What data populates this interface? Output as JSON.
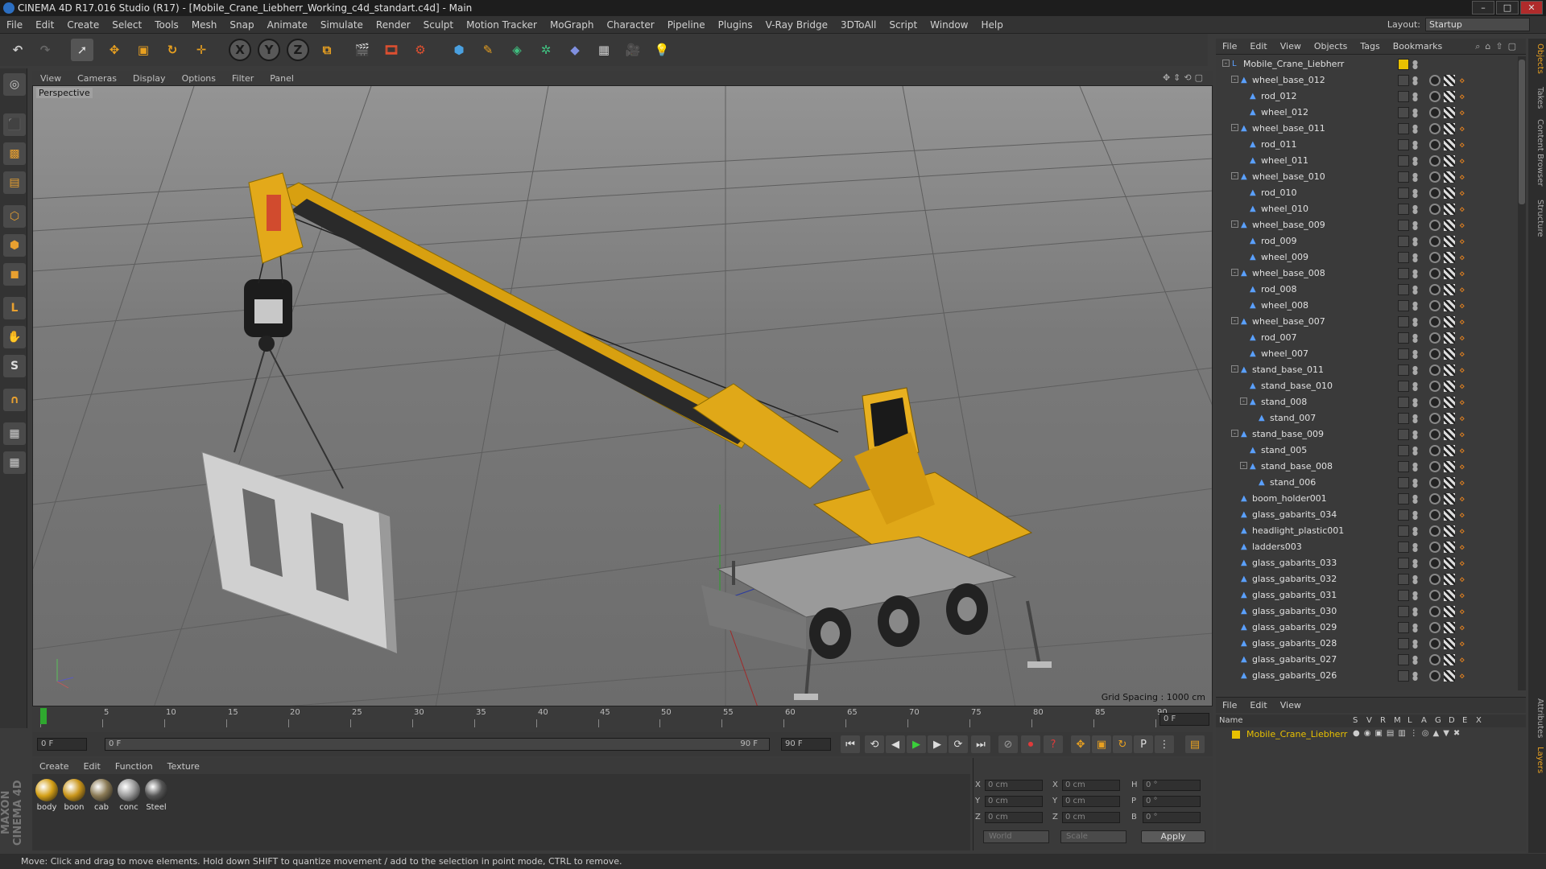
{
  "window": {
    "title": "CINEMA 4D R17.016 Studio (R17) - [Mobile_Crane_Liebherr_Working_c4d_standart.c4d] - Main"
  },
  "menubar": {
    "items": [
      "File",
      "Edit",
      "Create",
      "Select",
      "Tools",
      "Mesh",
      "Snap",
      "Animate",
      "Simulate",
      "Render",
      "Sculpt",
      "Motion Tracker",
      "MoGraph",
      "Character",
      "Pipeline",
      "Plugins",
      "V-Ray Bridge",
      "3DToAll",
      "Script",
      "Window",
      "Help"
    ],
    "layout_label": "Layout:",
    "layout_value": "Startup"
  },
  "toolbar": {
    "axis_x": "X",
    "axis_y": "Y",
    "axis_z": "Z"
  },
  "viewport": {
    "menu": [
      "View",
      "Cameras",
      "Display",
      "Options",
      "Filter",
      "Panel"
    ],
    "label": "Perspective",
    "grid_spacing": "Grid Spacing : 1000 cm"
  },
  "timeline": {
    "ticks": [
      "0",
      "5",
      "10",
      "15",
      "20",
      "25",
      "30",
      "35",
      "40",
      "45",
      "50",
      "55",
      "60",
      "65",
      "70",
      "75",
      "80",
      "85",
      "90"
    ],
    "current_frame": "0 F",
    "start_field": "0 F",
    "slider_left": "0 F",
    "slider_right": "90 F",
    "end_field": "90 F"
  },
  "materials": {
    "menu": [
      "Create",
      "Edit",
      "Function",
      "Texture"
    ],
    "items": [
      {
        "label": "body",
        "color": "#d4a017"
      },
      {
        "label": "boon",
        "color": "#c9951a"
      },
      {
        "label": "cab",
        "color": "#8a7a55"
      },
      {
        "label": "conc",
        "color": "#9a9a9a"
      },
      {
        "label": "Steel",
        "color": "#555555"
      }
    ]
  },
  "coords": {
    "x_label": "X",
    "y_label": "Y",
    "z_label": "Z",
    "x2_label": "X",
    "y2_label": "Y",
    "z2_label": "Z",
    "h_label": "H",
    "p_label": "P",
    "b_label": "B",
    "x_val": "0 cm",
    "y_val": "0 cm",
    "z_val": "0 cm",
    "x2_val": "0 cm",
    "y2_val": "0 cm",
    "z2_val": "0 cm",
    "h_val": "0 °",
    "p_val": "0 °",
    "b_val": "0 °",
    "world": "World",
    "scale": "Scale",
    "apply": "Apply"
  },
  "status": {
    "text": "Move: Click and drag to move elements. Hold down SHIFT to quantize movement / add to the selection in point mode, CTRL to remove."
  },
  "object_manager": {
    "menu": [
      "File",
      "Edit",
      "View",
      "Objects",
      "Tags",
      "Bookmarks"
    ],
    "objects": [
      {
        "name": "Mobile_Crane_Liebherr",
        "level": 0,
        "expand": "-"
      },
      {
        "name": "wheel_base_012",
        "level": 1,
        "expand": "-"
      },
      {
        "name": "rod_012",
        "level": 2,
        "expand": ""
      },
      {
        "name": "wheel_012",
        "level": 2,
        "expand": ""
      },
      {
        "name": "wheel_base_011",
        "level": 1,
        "expand": "-"
      },
      {
        "name": "rod_011",
        "level": 2,
        "expand": ""
      },
      {
        "name": "wheel_011",
        "level": 2,
        "expand": ""
      },
      {
        "name": "wheel_base_010",
        "level": 1,
        "expand": "-"
      },
      {
        "name": "rod_010",
        "level": 2,
        "expand": ""
      },
      {
        "name": "wheel_010",
        "level": 2,
        "expand": ""
      },
      {
        "name": "wheel_base_009",
        "level": 1,
        "expand": "-"
      },
      {
        "name": "rod_009",
        "level": 2,
        "expand": ""
      },
      {
        "name": "wheel_009",
        "level": 2,
        "expand": ""
      },
      {
        "name": "wheel_base_008",
        "level": 1,
        "expand": "-"
      },
      {
        "name": "rod_008",
        "level": 2,
        "expand": ""
      },
      {
        "name": "wheel_008",
        "level": 2,
        "expand": ""
      },
      {
        "name": "wheel_base_007",
        "level": 1,
        "expand": "-"
      },
      {
        "name": "rod_007",
        "level": 2,
        "expand": ""
      },
      {
        "name": "wheel_007",
        "level": 2,
        "expand": ""
      },
      {
        "name": "stand_base_011",
        "level": 1,
        "expand": "-"
      },
      {
        "name": "stand_base_010",
        "level": 2,
        "expand": ""
      },
      {
        "name": "stand_008",
        "level": 2,
        "expand": "-"
      },
      {
        "name": "stand_007",
        "level": 3,
        "expand": ""
      },
      {
        "name": "stand_base_009",
        "level": 1,
        "expand": "-"
      },
      {
        "name": "stand_005",
        "level": 2,
        "expand": ""
      },
      {
        "name": "stand_base_008",
        "level": 2,
        "expand": "-"
      },
      {
        "name": "stand_006",
        "level": 3,
        "expand": ""
      },
      {
        "name": "boom_holder001",
        "level": 1,
        "expand": ""
      },
      {
        "name": "glass_gabarits_034",
        "level": 1,
        "expand": ""
      },
      {
        "name": "headlight_plastic001",
        "level": 1,
        "expand": ""
      },
      {
        "name": "ladders003",
        "level": 1,
        "expand": ""
      },
      {
        "name": "glass_gabarits_033",
        "level": 1,
        "expand": ""
      },
      {
        "name": "glass_gabarits_032",
        "level": 1,
        "expand": ""
      },
      {
        "name": "glass_gabarits_031",
        "level": 1,
        "expand": ""
      },
      {
        "name": "glass_gabarits_030",
        "level": 1,
        "expand": ""
      },
      {
        "name": "glass_gabarits_029",
        "level": 1,
        "expand": ""
      },
      {
        "name": "glass_gabarits_028",
        "level": 1,
        "expand": ""
      },
      {
        "name": "glass_gabarits_027",
        "level": 1,
        "expand": ""
      },
      {
        "name": "glass_gabarits_026",
        "level": 1,
        "expand": ""
      }
    ]
  },
  "layer_manager": {
    "menu": [
      "File",
      "Edit",
      "View"
    ],
    "header_name": "Name",
    "header_cols": [
      "S",
      "V",
      "R",
      "M",
      "L",
      "A",
      "G",
      "D",
      "E",
      "X"
    ],
    "layer_name": "Mobile_Crane_Liebherr",
    "layer_color": "#e8c000"
  },
  "side_tabs": [
    "Objects",
    "Takes",
    "Content Browser",
    "Structure",
    "Attributes",
    "Layers"
  ]
}
